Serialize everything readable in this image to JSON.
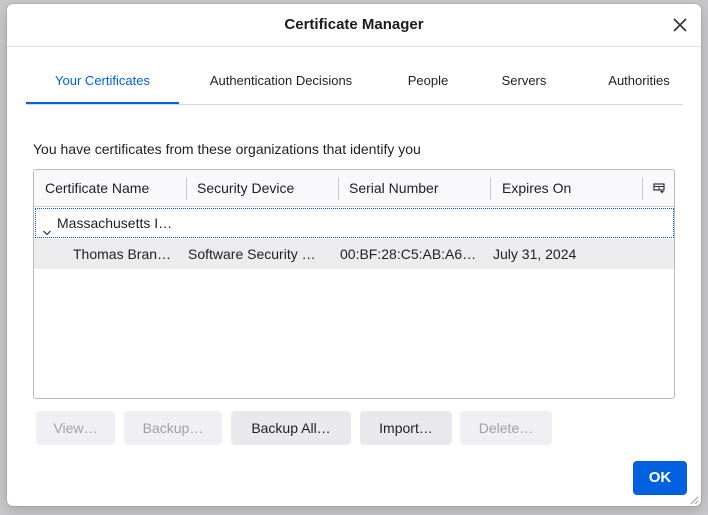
{
  "dialog": {
    "title": "Certificate Manager",
    "close_icon": "close-icon"
  },
  "tabs": [
    {
      "label": "Your Certificates",
      "active": true
    },
    {
      "label": "Authentication Decisions",
      "active": false
    },
    {
      "label": "People",
      "active": false
    },
    {
      "label": "Servers",
      "active": false
    },
    {
      "label": "Authorities",
      "active": false
    }
  ],
  "intro_text": "You have certificates from these organizations that identify you",
  "table": {
    "columns": [
      "Certificate Name",
      "Security Device",
      "Serial Number",
      "Expires On"
    ],
    "column_picker_icon": "column-picker-icon",
    "group": {
      "name": "Massachusetts I…",
      "expanded": true,
      "twisty_icon": "chevron-down-icon"
    },
    "rows": [
      {
        "certificate_name": "Thomas Bran…",
        "security_device": "Software Security …",
        "serial_number": "00:BF:28:C5:AB:A6…",
        "expires_on": "July 31, 2024"
      }
    ]
  },
  "buttons": {
    "view": "View…",
    "backup": "Backup…",
    "backup_all": "Backup All…",
    "import": "Import…",
    "delete": "Delete…"
  },
  "ok_label": "OK",
  "colors": {
    "accent": "#0061e0",
    "selected_row": "#ececef",
    "disabled_text": "#a0a0a6"
  }
}
